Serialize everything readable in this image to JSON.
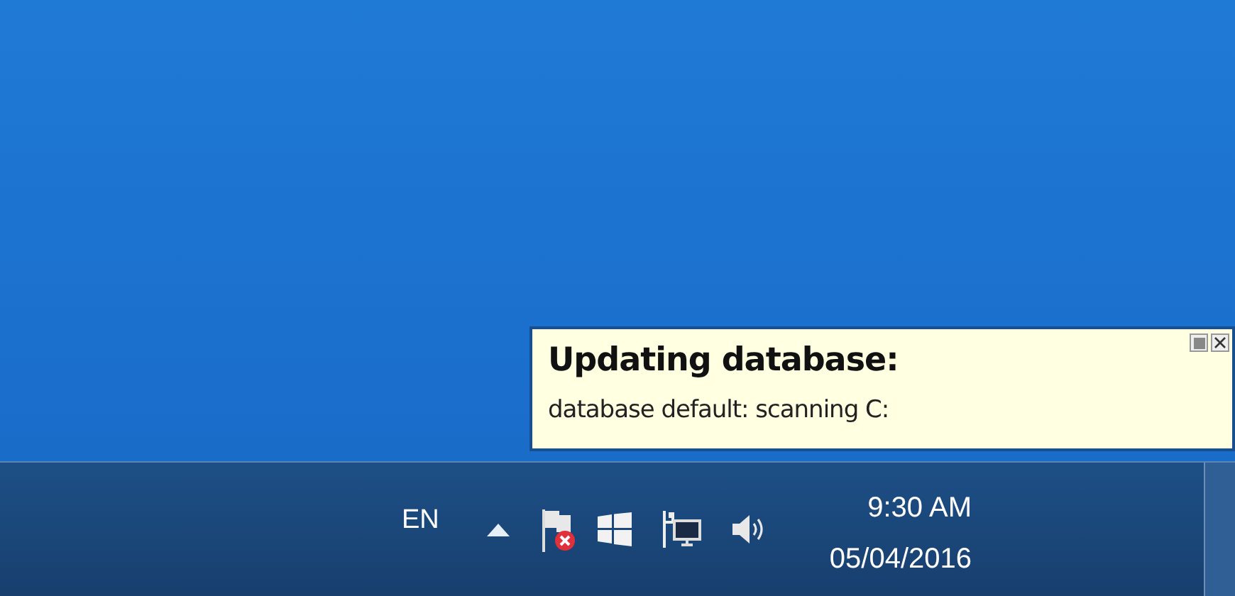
{
  "notification": {
    "title": "Updating database:",
    "message": "database default: scanning C:"
  },
  "taskbar": {
    "language": "EN",
    "time": "9:30 AM",
    "date": "05/04/2016"
  }
}
